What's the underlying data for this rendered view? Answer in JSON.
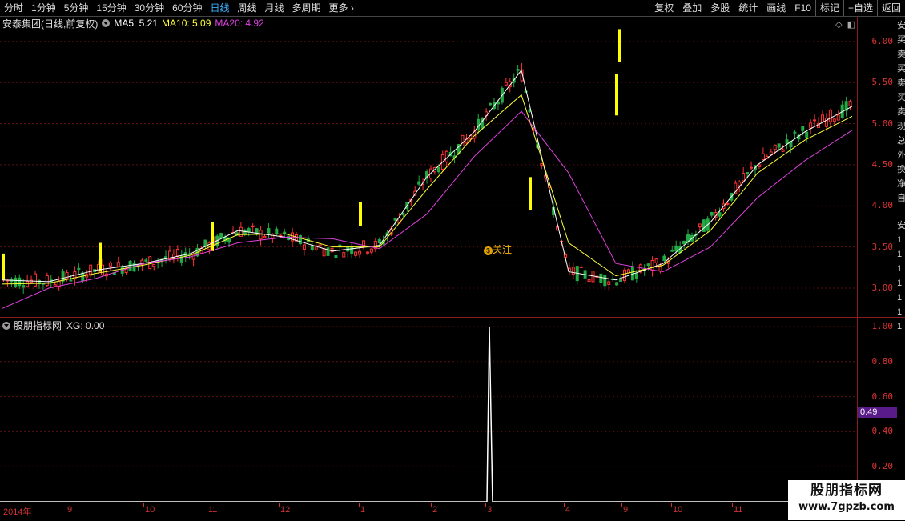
{
  "toolbar": {
    "periods": [
      "分时",
      "1分钟",
      "5分钟",
      "15分钟",
      "30分钟",
      "60分钟",
      "日线",
      "周线",
      "月线",
      "多周期",
      "更多"
    ],
    "active_period": "日线",
    "buttons": [
      "复权",
      "叠加",
      "多股",
      "统计",
      "画线",
      "F10",
      "标记",
      "+自选",
      "返回"
    ]
  },
  "main_chart": {
    "stock_name": "安泰集团(日线,前复权)",
    "ma5_label": "MA5: 5.21",
    "ma10_label": "MA10: 5.09",
    "ma20_label": "MA20: 4.92",
    "colors": {
      "ma5": "#ffffff",
      "ma10": "#ffff33",
      "ma20": "#e040e0",
      "up": "#ff3333",
      "down": "#22aa44",
      "signal": "#ffff00"
    },
    "marker_label": "关注",
    "y_ticks": [
      "6.00",
      "5.50",
      "5.00",
      "4.50",
      "4.00",
      "3.50",
      "3.00"
    ]
  },
  "sub_chart": {
    "title": "股朋指标网",
    "xg_label": "XG: 0.00",
    "y_ticks": [
      "1.00",
      "0.80",
      "0.60",
      "0.40",
      "0.20"
    ],
    "value_badge": "0.49"
  },
  "date_axis": {
    "labels": [
      "2014年",
      "9",
      "10",
      "11",
      "12",
      "1",
      "2",
      "3",
      "4",
      "9",
      "10",
      "11"
    ]
  },
  "right_strip": [
    "安",
    "买",
    "卖",
    "买",
    "卖",
    "买",
    "卖",
    "现",
    "总",
    "外",
    "换",
    "净",
    "自",
    "安",
    "1",
    "1",
    "1",
    "1",
    "1",
    "1",
    "1"
  ],
  "watermark": {
    "title": "股朋指标网",
    "url": "www.7gpzb.com"
  },
  "chart_data": [
    {
      "type": "line",
      "title": "安泰集团(日线,前复权)",
      "xlabel": "",
      "ylabel": "",
      "ylim": [
        2.65,
        6.3
      ],
      "categories": [
        "2014年",
        "9",
        "10",
        "11",
        "12",
        "1",
        "2",
        "3",
        "4",
        "9",
        "10",
        "11"
      ],
      "series": [
        {
          "name": "MA5",
          "values": [
            3.1,
            3.08,
            3.22,
            3.3,
            3.42,
            3.7,
            3.62,
            3.45,
            3.52,
            4.35,
            4.9,
            5.65,
            3.2,
            3.1,
            3.3,
            3.8,
            4.5,
            4.9,
            5.21
          ]
        },
        {
          "name": "MA10",
          "values": [
            3.05,
            3.06,
            3.18,
            3.28,
            3.4,
            3.65,
            3.66,
            3.5,
            3.5,
            4.2,
            4.85,
            5.35,
            3.55,
            3.15,
            3.28,
            3.7,
            4.4,
            4.8,
            5.09
          ]
        },
        {
          "name": "MA20",
          "values": [
            2.75,
            3.0,
            3.12,
            3.3,
            3.38,
            3.55,
            3.62,
            3.6,
            3.48,
            3.9,
            4.6,
            5.15,
            4.4,
            3.3,
            3.2,
            3.5,
            4.1,
            4.55,
            4.92
          ]
        }
      ]
    },
    {
      "type": "line",
      "title": "股朋指标网",
      "xlabel": "",
      "ylabel": "",
      "ylim": [
        0,
        1.05
      ],
      "series": [
        {
          "name": "XG",
          "values": [
            0,
            0,
            0,
            0,
            0,
            0,
            0,
            0,
            1.0,
            0,
            0,
            0,
            0,
            0,
            0,
            0,
            0,
            0,
            0
          ]
        }
      ]
    }
  ]
}
